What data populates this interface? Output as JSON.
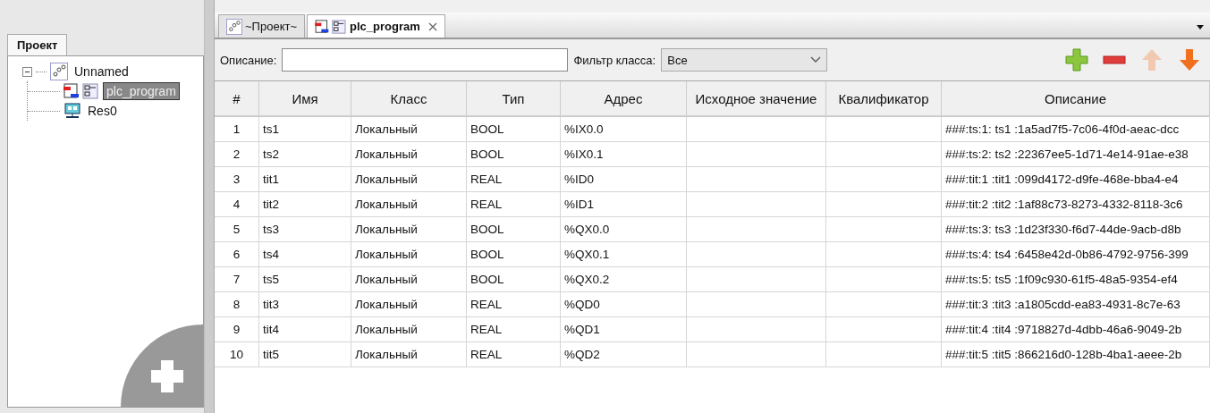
{
  "left_panel": {
    "tabs": [
      {
        "label": "Проект",
        "selected": true
      }
    ],
    "tree": [
      {
        "label": "Unnamed",
        "expanded": true,
        "selected": false,
        "children": [
          {
            "label": "plc_program",
            "selected": true
          },
          {
            "label": "Res0",
            "selected": false
          }
        ]
      }
    ]
  },
  "editor_tabs": [
    {
      "label": "~Проект~",
      "selected": false,
      "closable": false
    },
    {
      "label": "plc_program",
      "selected": true,
      "closable": true
    }
  ],
  "toolbar": {
    "description_label": "Описание:",
    "filter_label": "Фильтр класса:",
    "filter_value": "Все",
    "buttons": [
      {
        "kind": "add",
        "disabled": false
      },
      {
        "kind": "remove",
        "disabled": false
      },
      {
        "kind": "up",
        "disabled": true
      },
      {
        "kind": "down",
        "disabled": false
      }
    ]
  },
  "table": {
    "columns": [
      "#",
      "Имя",
      "Класс",
      "Тип",
      "Адрес",
      "Исходное значение",
      "Квалификатор",
      "Описание"
    ],
    "rows": [
      [
        "1",
        "ts1",
        "Локальный",
        "BOOL",
        "%IX0.0",
        "",
        "",
        "###:ts:1: ts1 :1a5ad7f5-7c06-4f0d-aeac-dcc"
      ],
      [
        "2",
        "ts2",
        "Локальный",
        "BOOL",
        "%IX0.1",
        "",
        "",
        "###:ts:2: ts2 :22367ee5-1d71-4e14-91ae-e38"
      ],
      [
        "3",
        "tit1",
        "Локальный",
        "REAL",
        "%ID0",
        "",
        "",
        "###:tit:1 :tit1 :099d4172-d9fe-468e-bba4-e4"
      ],
      [
        "4",
        "tit2",
        "Локальный",
        "REAL",
        "%ID1",
        "",
        "",
        "###:tit:2 :tit2 :1af88c73-8273-4332-8118-3c6"
      ],
      [
        "5",
        "ts3",
        "Локальный",
        "BOOL",
        "%QX0.0",
        "",
        "",
        "###:ts:3: ts3 :1d23f330-f6d7-44de-9acb-d8b"
      ],
      [
        "6",
        "ts4",
        "Локальный",
        "BOOL",
        "%QX0.1",
        "",
        "",
        "###:ts:4: ts4 :6458e42d-0b86-4792-9756-399"
      ],
      [
        "7",
        "ts5",
        "Локальный",
        "BOOL",
        "%QX0.2",
        "",
        "",
        "###:ts:5: ts5 :1f09c930-61f5-48a5-9354-ef4"
      ],
      [
        "8",
        "tit3",
        "Локальный",
        "REAL",
        "%QD0",
        "",
        "",
        "###:tit:3 :tit3 :a1805cdd-ea83-4931-8c7e-63"
      ],
      [
        "9",
        "tit4",
        "Локальный",
        "REAL",
        "%QD1",
        "",
        "",
        "###:tit:4 :tit4 :9718827d-4dbb-46a6-9049-2b"
      ],
      [
        "10",
        "tit5",
        "Локальный",
        "REAL",
        "%QD2",
        "",
        "",
        "###:tit:5 :tit5 :866216d0-128b-4ba1-aeee-2b"
      ]
    ]
  }
}
